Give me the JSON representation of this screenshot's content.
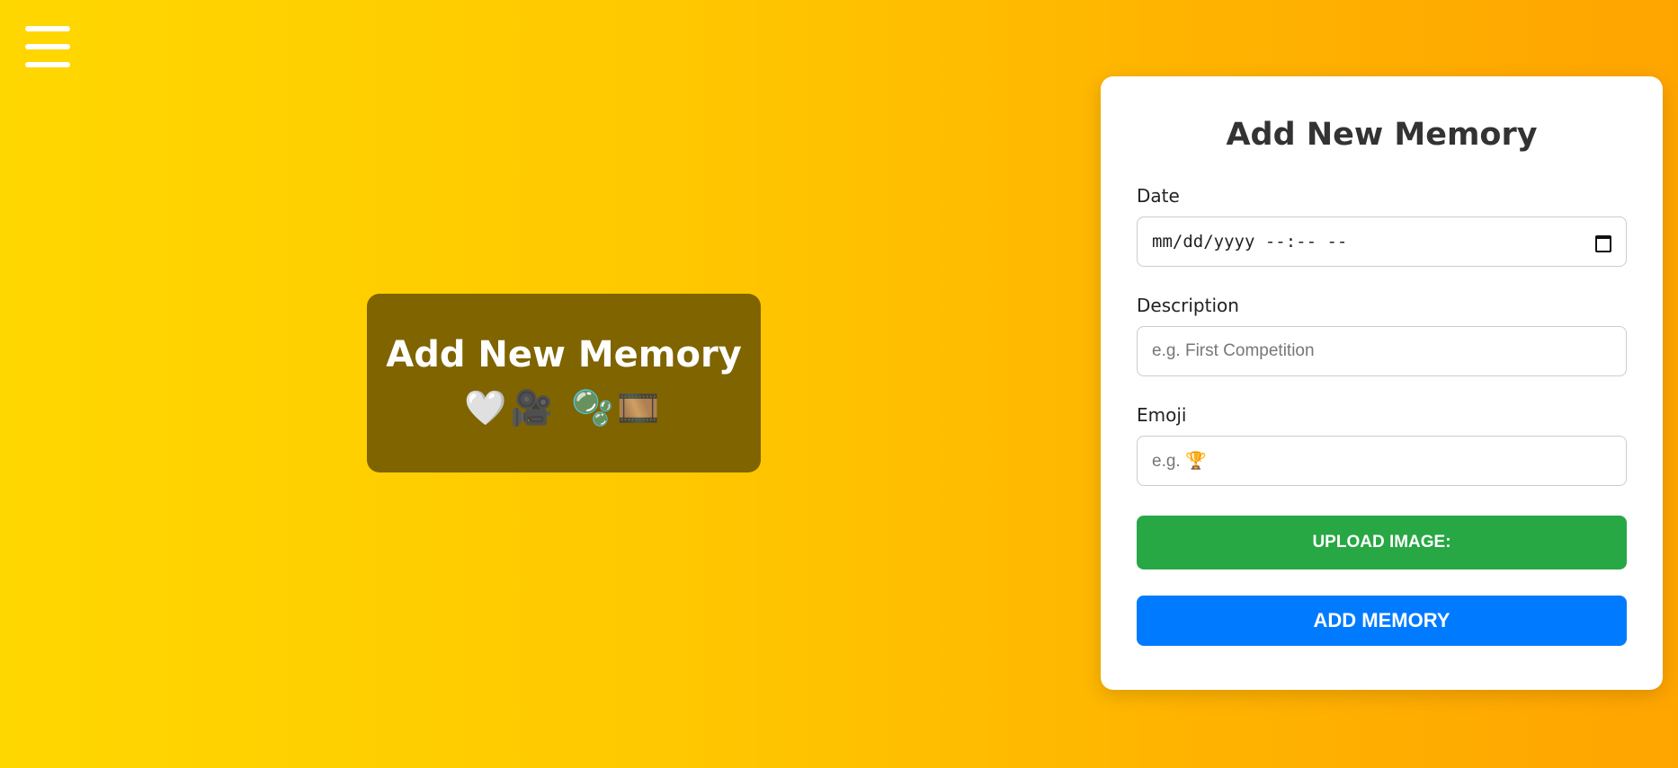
{
  "banner": {
    "title": "Add New Memory",
    "emojis": "🤍🎥 🫧🎞️"
  },
  "form": {
    "title": "Add New Memory",
    "date_label": "Date",
    "date_placeholder": "mm/dd/yyyy --:-- --",
    "description_label": "Description",
    "description_placeholder": "e.g. First Competition",
    "emoji_label": "Emoji",
    "emoji_placeholder": "e.g. 🏆",
    "upload_button": "UPLOAD IMAGE:",
    "add_button": "ADD MEMORY"
  },
  "colors": {
    "background_start": "#ffd700",
    "background_end": "#ffa500",
    "banner_bg": "#7f6400",
    "upload_button": "#28a745",
    "add_button": "#007bff"
  },
  "icons": [
    "hamburger-menu-icon",
    "calendar-icon"
  ]
}
